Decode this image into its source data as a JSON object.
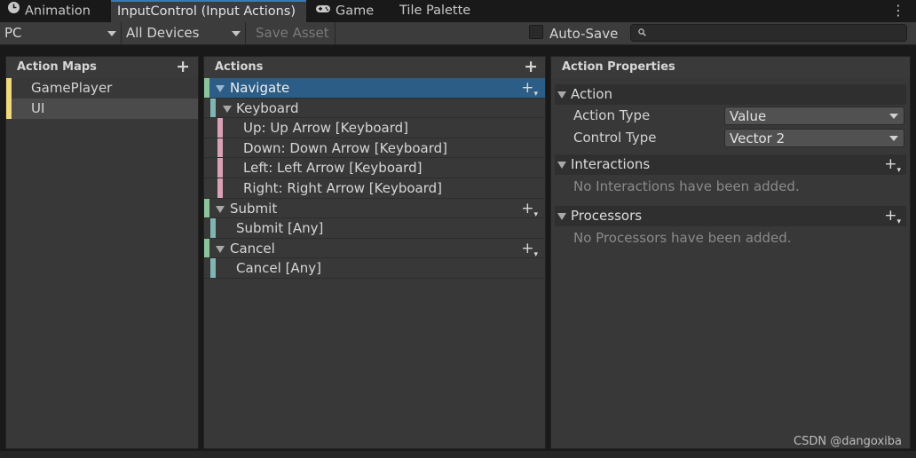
{
  "tabs": [
    {
      "label": "Animation",
      "icon": "clock-icon"
    },
    {
      "label": "InputControl (Input Actions)",
      "icon": ""
    },
    {
      "label": "Game",
      "icon": "gamepad-icon"
    },
    {
      "label": "Tile Palette",
      "icon": ""
    }
  ],
  "toolbar": {
    "scheme": "PC",
    "devices": "All Devices",
    "save_asset": "Save Asset",
    "auto_save": "Auto-Save",
    "search_value": ""
  },
  "action_maps": {
    "title": "Action Maps",
    "items": [
      {
        "label": "GamePlayer"
      },
      {
        "label": "UI"
      }
    ]
  },
  "actions": {
    "title": "Actions",
    "rows": [
      {
        "label": "Navigate",
        "kind": "action"
      },
      {
        "label": "Keyboard",
        "kind": "composite"
      },
      {
        "label": "Up: Up Arrow [Keyboard]",
        "kind": "part"
      },
      {
        "label": "Down: Down Arrow [Keyboard]",
        "kind": "part"
      },
      {
        "label": "Left: Left Arrow [Keyboard]",
        "kind": "part"
      },
      {
        "label": "Right: Right Arrow [Keyboard]",
        "kind": "part"
      },
      {
        "label": "Submit",
        "kind": "action"
      },
      {
        "label": "Submit [Any]",
        "kind": "binding"
      },
      {
        "label": "Cancel",
        "kind": "action"
      },
      {
        "label": "Cancel [Any]",
        "kind": "binding"
      }
    ]
  },
  "properties": {
    "title": "Action Properties",
    "action_section": "Action",
    "action_type_label": "Action Type",
    "action_type_value": "Value",
    "control_type_label": "Control Type",
    "control_type_value": "Vector 2",
    "interactions_section": "Interactions",
    "interactions_empty": "No Interactions have been added.",
    "processors_section": "Processors",
    "processors_empty": "No Processors have been added."
  },
  "watermark": "CSDN @dangoxiba",
  "colors": {
    "accent": "#3a79bb",
    "selection": "#2c5d87",
    "map_bar": "#efd97c",
    "action_bar": "#8bc49a",
    "binding_bar": "#7fb6b5",
    "part_bar": "#d9a1b6"
  }
}
